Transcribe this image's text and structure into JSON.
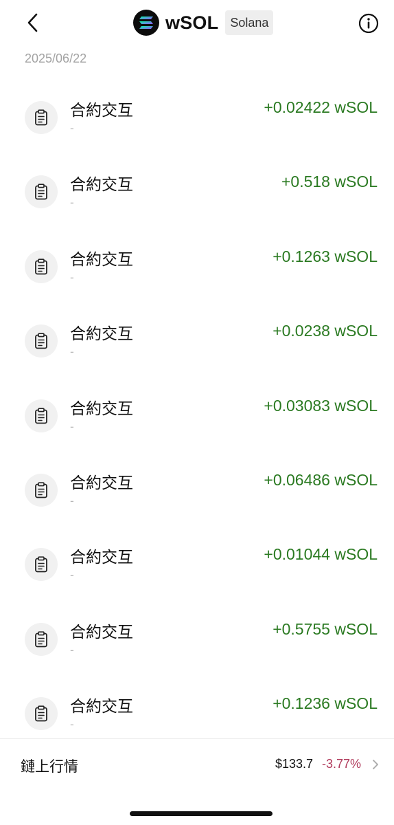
{
  "header": {
    "back_icon": "chevron-left-icon",
    "token_logo_icon": "solana-logo-icon",
    "token_symbol": "wSOL",
    "chain_name": "Solana",
    "info_icon": "info-circle-icon"
  },
  "list": {
    "date": "2025/06/22",
    "items": [
      {
        "title": "合約交互",
        "subtitle": "-",
        "amount": "+0.02422 wSOL"
      },
      {
        "title": "合約交互",
        "subtitle": "-",
        "amount": "+0.518 wSOL"
      },
      {
        "title": "合約交互",
        "subtitle": "-",
        "amount": "+0.1263 wSOL"
      },
      {
        "title": "合約交互",
        "subtitle": "-",
        "amount": "+0.0238 wSOL"
      },
      {
        "title": "合約交互",
        "subtitle": "-",
        "amount": "+0.03083 wSOL"
      },
      {
        "title": "合約交互",
        "subtitle": "-",
        "amount": "+0.06486 wSOL"
      },
      {
        "title": "合約交互",
        "subtitle": "-",
        "amount": "+0.01044 wSOL"
      },
      {
        "title": "合約交互",
        "subtitle": "-",
        "amount": "+0.5755 wSOL"
      },
      {
        "title": "合約交互",
        "subtitle": "-",
        "amount": "+0.1236 wSOL"
      }
    ],
    "item_icon": "clipboard-icon"
  },
  "footer": {
    "market_label": "鏈上行情",
    "price": "$133.7",
    "change": "-3.77%",
    "chevron_icon": "chevron-right-icon"
  },
  "colors": {
    "amount_positive": "#2b7a22",
    "change_negative": "#b03a5b",
    "secondary_text": "#a3a3a3"
  }
}
